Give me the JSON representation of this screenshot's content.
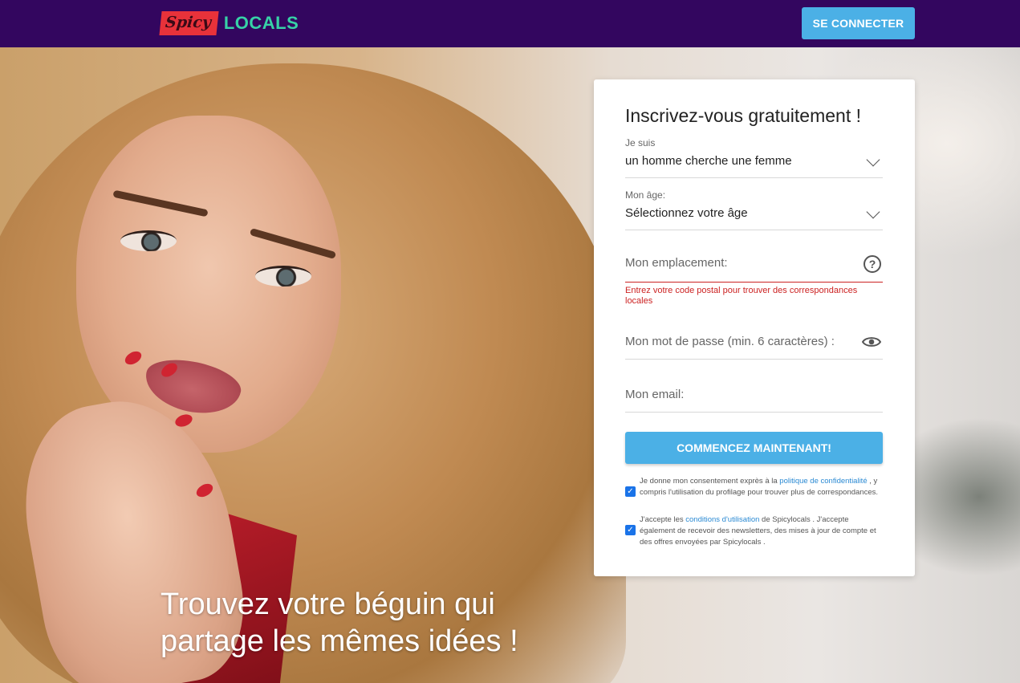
{
  "header": {
    "logo_part1": "Spicy",
    "logo_part2": "LOCALS",
    "login_label": "SE CONNECTER"
  },
  "hero": {
    "tagline_line1": "Trouvez votre béguin qui",
    "tagline_line2": "partage les mêmes idées !"
  },
  "form": {
    "title": "Inscrivez-vous gratuitement !",
    "seeking": {
      "label": "Je suis",
      "value": "un homme cherche une femme"
    },
    "age": {
      "label": "Mon âge:",
      "value": "Sélectionnez votre âge"
    },
    "location": {
      "placeholder": "Mon emplacement:",
      "help_icon": "question-circle-icon",
      "error": "Entrez votre code postal pour trouver des correspondances locales"
    },
    "password": {
      "placeholder": "Mon mot de passe (min. 6 caractères) :",
      "toggle_icon": "eye-icon"
    },
    "email": {
      "placeholder": "Mon email:"
    },
    "submit_label": "COMMENCEZ MAINTENANT!",
    "consent1": {
      "checked": true,
      "before": "Je donne mon consentement exprès à la",
      "link": "politique de confidentialité",
      "after": ", y compris l'utilisation du profilage pour trouver plus de correspondances."
    },
    "consent2": {
      "checked": true,
      "before": "J'accepte les",
      "link": "conditions d'utilisation",
      "after": "de Spicylocals . J'accepte également de recevoir des newsletters, des mises à jour de compte et des offres envoyées par Spicylocals ."
    }
  },
  "colors": {
    "header_bg": "#33065f",
    "accent_blue": "#4bb0e6",
    "logo_red": "#e8323a",
    "logo_green": "#37d2a7",
    "error_red": "#cc2222"
  }
}
